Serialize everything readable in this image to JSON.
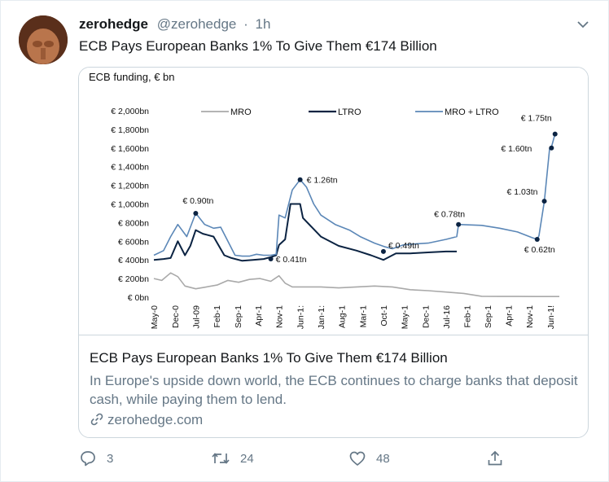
{
  "user": {
    "name": "zerohedge",
    "handle": "@zerohedge",
    "separator": "·",
    "time": "1h"
  },
  "tweet": {
    "text": "ECB Pays European Banks 1% To Give Them €174 Billion"
  },
  "card": {
    "title": "ECB Pays European Banks 1% To Give Them €174 Billion",
    "description": "In Europe's upside down world, the ECB continues to charge banks that deposit cash, while paying them to lend.",
    "domain": "zerohedge.com"
  },
  "actions": {
    "replies": "3",
    "retweets": "24",
    "likes": "48"
  },
  "icons": {
    "more": "chevron-down-icon",
    "reply": "reply-icon",
    "retweet": "retweet-icon",
    "like": "heart-icon",
    "share": "share-icon",
    "link": "link-icon"
  },
  "colors": {
    "mro": "#a9a9a9",
    "ltro": "#0b2342",
    "mro_ltro": "#5b87b7",
    "secondary_text": "#657786",
    "border": "#ccd6dd"
  },
  "chart_data": {
    "type": "line",
    "title": "ECB funding, € bn",
    "ylim": [
      0,
      2000
    ],
    "yticks": [
      0,
      200,
      400,
      600,
      800,
      1000,
      1200,
      1400,
      1600,
      1800,
      2000
    ],
    "ytick_labels": [
      "€ 0bn",
      "€ 200bn",
      "€ 400bn",
      "€ 600bn",
      "€ 800bn",
      "€ 1,000bn",
      "€ 1,200bn",
      "€ 1,400bn",
      "€ 1,600bn",
      "€ 1,800bn",
      "€ 2,000bn"
    ],
    "xlim": [
      2008.33,
      2019.67
    ],
    "xticks": [
      2008.33,
      2008.92,
      2009.5,
      2010.08,
      2010.67,
      2011.25,
      2011.83,
      2012.42,
      2013.0,
      2013.58,
      2014.17,
      2014.75,
      2015.33,
      2015.92,
      2016.5,
      2017.08,
      2017.67,
      2018.25,
      2018.83,
      2019.42
    ],
    "xtick_labels": [
      "May-0",
      "Dec-0",
      "Jul-09",
      "Feb-1",
      "Sep-1",
      "Apr-1",
      "Nov-1",
      "Jun-1:",
      "Jan-1:",
      "Aug-1",
      "Mar-1",
      "Oct-1",
      "May-1",
      "Dec-1",
      "Jul-16",
      "Feb-1",
      "Sep-1",
      "Apr-1",
      "Nov-1",
      "Jun-1!"
    ],
    "legend": {
      "placement": "top",
      "entries": [
        "MRO",
        "LTRO",
        "MRO + LTRO"
      ]
    },
    "series": [
      {
        "name": "MRO",
        "color": "#a9a9a9",
        "x": [
          2008.33,
          2008.55,
          2008.8,
          2009.0,
          2009.2,
          2009.5,
          2009.8,
          2010.1,
          2010.4,
          2010.7,
          2011.0,
          2011.3,
          2011.6,
          2011.83,
          2012.0,
          2012.2,
          2012.5,
          2013.0,
          2013.5,
          2014.0,
          2014.5,
          2015.0,
          2015.5,
          2016.0,
          2016.5,
          2017.0,
          2017.5,
          2018.0,
          2018.5,
          2019.0,
          2019.67
        ],
        "y": [
          200,
          180,
          260,
          220,
          120,
          90,
          110,
          130,
          180,
          160,
          190,
          200,
          170,
          230,
          150,
          110,
          110,
          110,
          100,
          110,
          120,
          110,
          80,
          70,
          55,
          40,
          10,
          8,
          8,
          7,
          7
        ]
      },
      {
        "name": "LTRO",
        "color": "#0b2342",
        "x": [
          2008.33,
          2008.6,
          2008.8,
          2009.0,
          2009.2,
          2009.35,
          2009.5,
          2009.7,
          2010.0,
          2010.3,
          2010.5,
          2010.8,
          2011.1,
          2011.4,
          2011.6,
          2011.75,
          2011.83,
          2012.0,
          2012.15,
          2012.42,
          2012.5,
          2013.0,
          2013.5,
          2014.0,
          2014.4,
          2014.75,
          2015.1,
          2015.5,
          2016.0,
          2016.5,
          2016.8
        ],
        "y": [
          400,
          410,
          420,
          600,
          450,
          550,
          720,
          680,
          650,
          450,
          420,
          390,
          400,
          410,
          430,
          450,
          560,
          620,
          1000,
          1000,
          850,
          650,
          550,
          500,
          450,
          400,
          470,
          470,
          480,
          490,
          490
        ]
      },
      {
        "name": "MRO + LTRO",
        "color": "#5b87b7",
        "x": [
          2008.33,
          2008.6,
          2008.8,
          2009.0,
          2009.25,
          2009.5,
          2009.75,
          2010.0,
          2010.2,
          2010.4,
          2010.6,
          2010.8,
          2011.0,
          2011.2,
          2011.4,
          2011.6,
          2011.75,
          2011.83,
          2012.0,
          2012.2,
          2012.42,
          2012.6,
          2012.8,
          2013.0,
          2013.4,
          2013.8,
          2014.1,
          2014.5,
          2014.8,
          2015.0,
          2015.3,
          2015.6,
          2016.0,
          2016.5,
          2016.8,
          2016.85,
          2017.5,
          2018.0,
          2018.5,
          2018.9,
          2019.05,
          2019.1,
          2019.25,
          2019.4,
          2019.45,
          2019.55
        ],
        "y": [
          450,
          500,
          650,
          780,
          650,
          900,
          780,
          740,
          750,
          600,
          450,
          440,
          440,
          460,
          450,
          450,
          460,
          880,
          850,
          1150,
          1260,
          1180,
          1000,
          880,
          780,
          720,
          650,
          580,
          540,
          520,
          560,
          570,
          580,
          620,
          650,
          780,
          770,
          740,
          700,
          640,
          620,
          660,
          1030,
          1600,
          1610,
          1750
        ]
      }
    ],
    "annotations": [
      {
        "text": "€ 0.90tn",
        "x": 2009.5,
        "y": 900
      },
      {
        "text": "€ 1.26tn",
        "x": 2012.42,
        "y": 1260
      },
      {
        "text": "€ 0.41tn",
        "x": 2011.6,
        "y": 410
      },
      {
        "text": "€ 0.49tn",
        "x": 2014.75,
        "y": 490
      },
      {
        "text": "€ 0.78tn",
        "x": 2016.85,
        "y": 780
      },
      {
        "text": "€ 1.75tn",
        "x": 2019.55,
        "y": 1750
      },
      {
        "text": "€ 1.60tn",
        "x": 2019.45,
        "y": 1600
      },
      {
        "text": "€ 1.03tn",
        "x": 2019.25,
        "y": 1030
      },
      {
        "text": "€ 0.62tn",
        "x": 2019.05,
        "y": 620
      }
    ]
  }
}
